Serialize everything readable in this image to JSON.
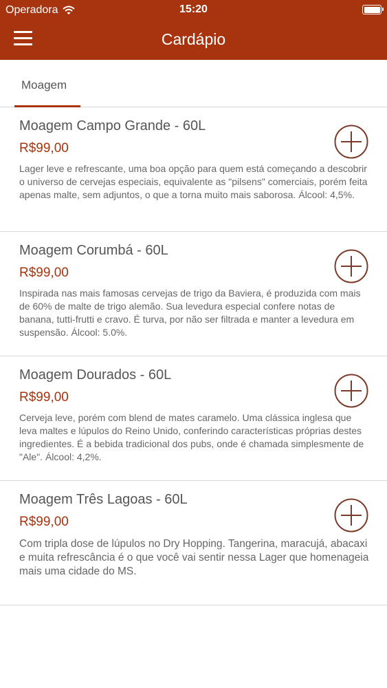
{
  "status_bar": {
    "carrier": "Operadora",
    "time": "15:20"
  },
  "nav": {
    "title": "Cardápio"
  },
  "tabs": [
    {
      "label": "Moagem"
    }
  ],
  "accent_color": "#a7340f",
  "products": [
    {
      "name": "Moagem Campo Grande - 60L",
      "price": "R$99,00",
      "description": "Lager leve e refrescante, uma boa opção para quem está começando a descobrir o universo de cervejas especiais, equivalente as \"pilsens\" comerciais, porém feita apenas malte, sem adjuntos, o que a torna muito mais saborosa. Álcool: 4,5%."
    },
    {
      "name": "Moagem Corumbá - 60L",
      "price": "R$99,00",
      "description": "Inspirada nas mais famosas cervejas de trigo da Baviera, é produzida com mais de 60% de malte de trigo alemão. Sua levedura especial confere notas de banana, tutti-frutti e cravo. É turva, por não ser filtrada e manter a levedura em suspensão. Álcool: 5.0%."
    },
    {
      "name": "Moagem Dourados - 60L",
      "price": "R$99,00",
      "description": "Cerveja leve, porém com blend de mates caramelo. Uma clássica inglesa que leva maltes e lúpulos do Reino Unido, conferindo características próprias destes ingredientes. É a bebida tradicional dos pubs, onde é chamada simplesmente de \"Ale\". Álcool: 4,2%."
    },
    {
      "name": "Moagem Três Lagoas - 60L",
      "price": "R$99,00",
      "description": "Com tripla dose de lúpulos no Dry Hopping. Tangerina, maracujá, abacaxi e muita refrescância é o que você vai sentir nessa Lager que homenageia mais uma cidade do MS."
    }
  ]
}
